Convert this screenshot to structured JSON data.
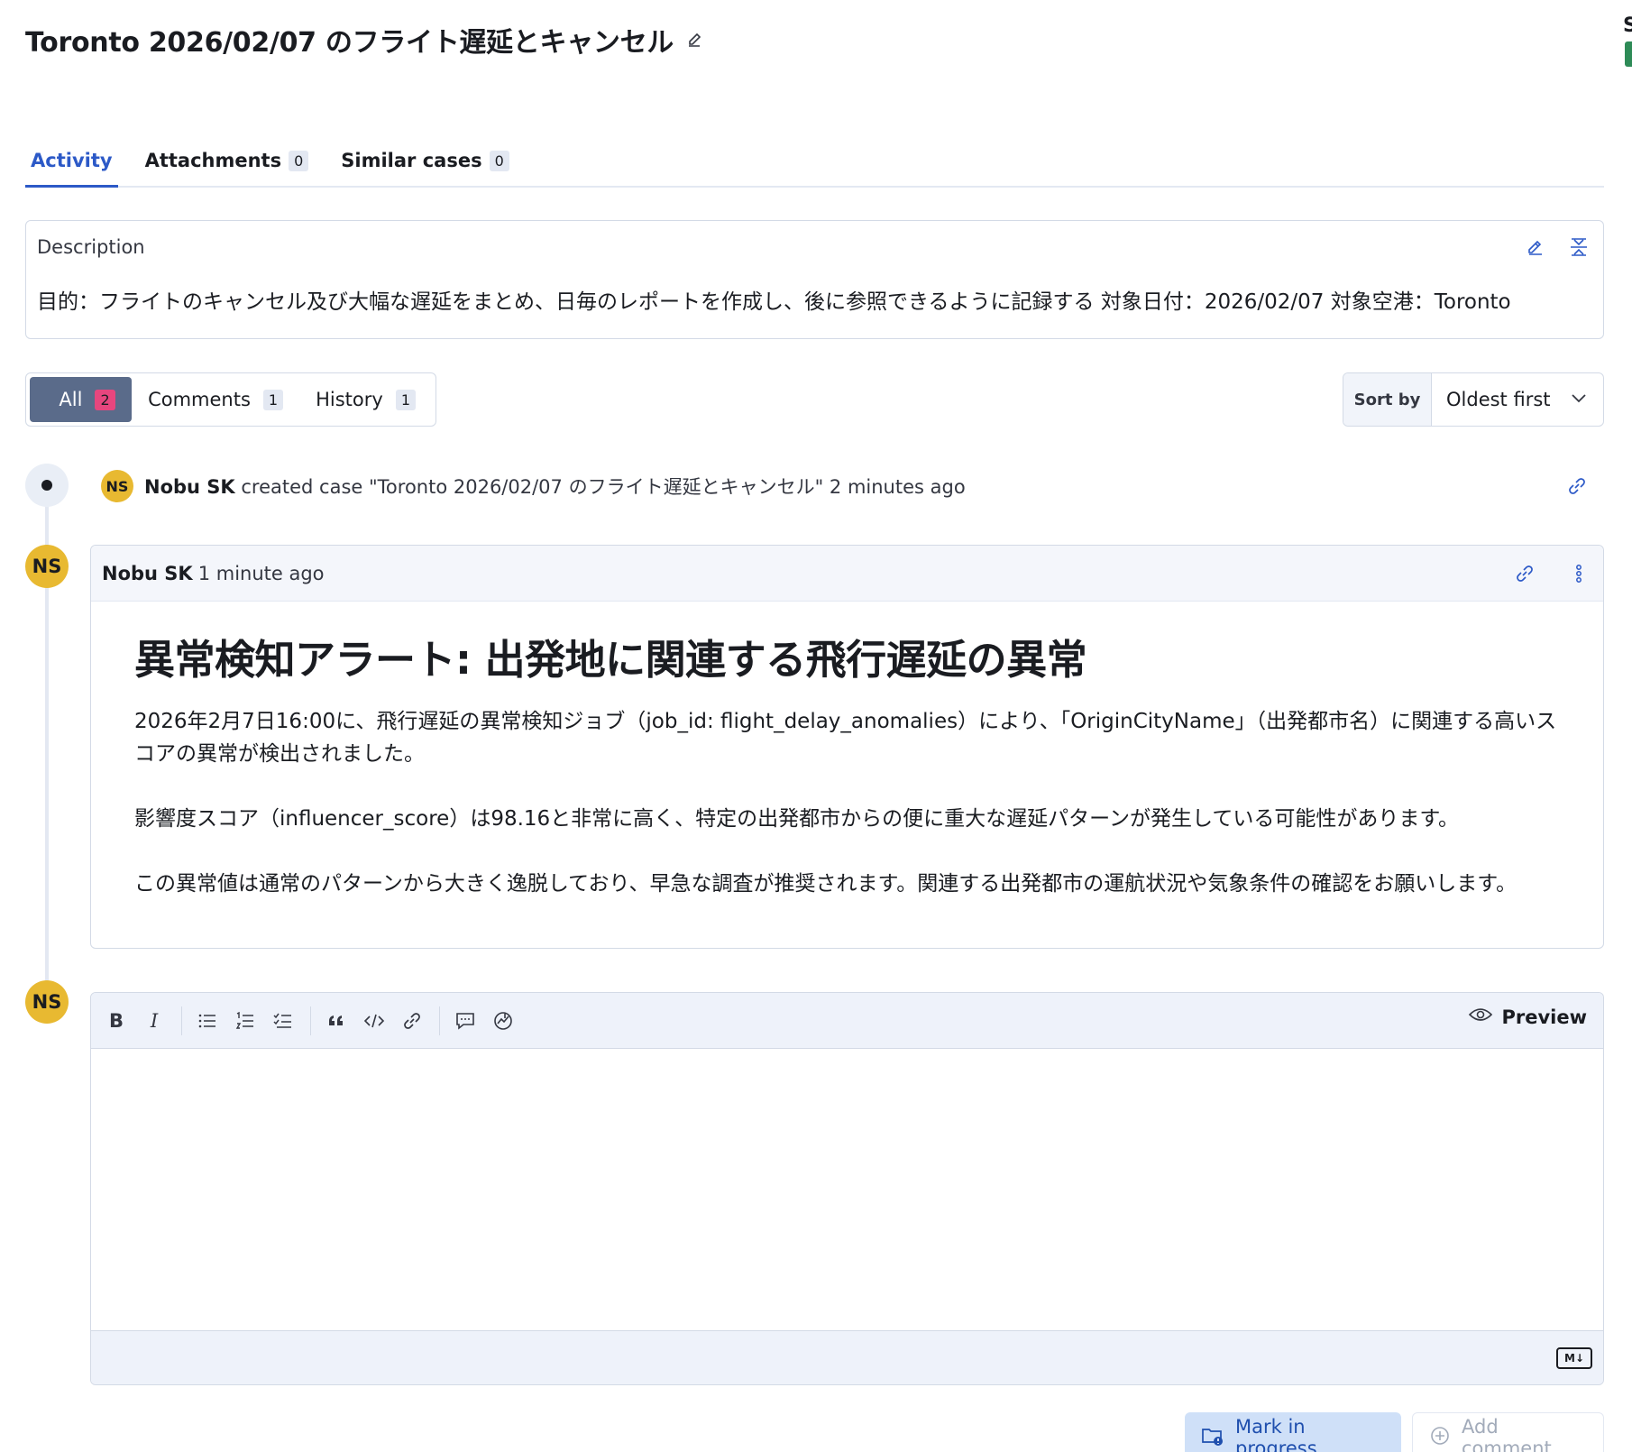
{
  "case": {
    "title": "Toronto 2026/02/07 のフライト遅延とキャンセル",
    "edge_letter": "S"
  },
  "tabs": [
    {
      "label": "Activity",
      "count": null,
      "active": true
    },
    {
      "label": "Attachments",
      "count": "0"
    },
    {
      "label": "Similar cases",
      "count": "0"
    }
  ],
  "description": {
    "label": "Description",
    "text": "目的：フライトのキャンセル及び大幅な遅延をまとめ、日毎のレポートを作成し、後に参照できるように記録する 対象日付：2026/02/07 対象空港：Toronto"
  },
  "filters": [
    {
      "label": "All",
      "count": "2",
      "active": true
    },
    {
      "label": "Comments",
      "count": "1"
    },
    {
      "label": "History",
      "count": "1"
    }
  ],
  "sort": {
    "label": "Sort by",
    "value": "Oldest first"
  },
  "event": {
    "avatar": "NS",
    "user": "Nobu SK",
    "text": "created case \"Toronto 2026/02/07 のフライト遅延とキャンセル\" 2 minutes ago"
  },
  "comment": {
    "avatar": "NS",
    "user": "Nobu SK",
    "time": "1 minute ago",
    "heading": "異常検知アラート: 出発地に関連する飛行遅延の異常",
    "paragraphs": [
      "2026年2月7日16:00に、飛行遅延の異常検知ジョブ（job_id: flight_delay_anomalies）により、「OriginCityName」（出発都市名）に関連する高いスコアの異常が検出されました。",
      "影響度スコア（influencer_score）は98.16と非常に高く、特定の出発都市からの便に重大な遅延パターンが発生している可能性があります。",
      "この異常値は通常のパターンから大きく逸脱しており、早急な調査が推奨されます。関連する出発都市の運航状況や気象条件の確認をお願いします。"
    ]
  },
  "editor": {
    "avatar": "NS",
    "bold": "B",
    "italic": "I",
    "preview_label": "Preview",
    "md_badge": "M↓",
    "value": ""
  },
  "actions": {
    "mark_in_progress": "Mark in progress",
    "add_comment": "Add comment"
  },
  "colors": {
    "accent": "#2c59c7",
    "avatar": "#e8b931",
    "active_filter": "#5a6b8a",
    "count_badge": "#e7467e",
    "status_green": "#2e8b57"
  }
}
